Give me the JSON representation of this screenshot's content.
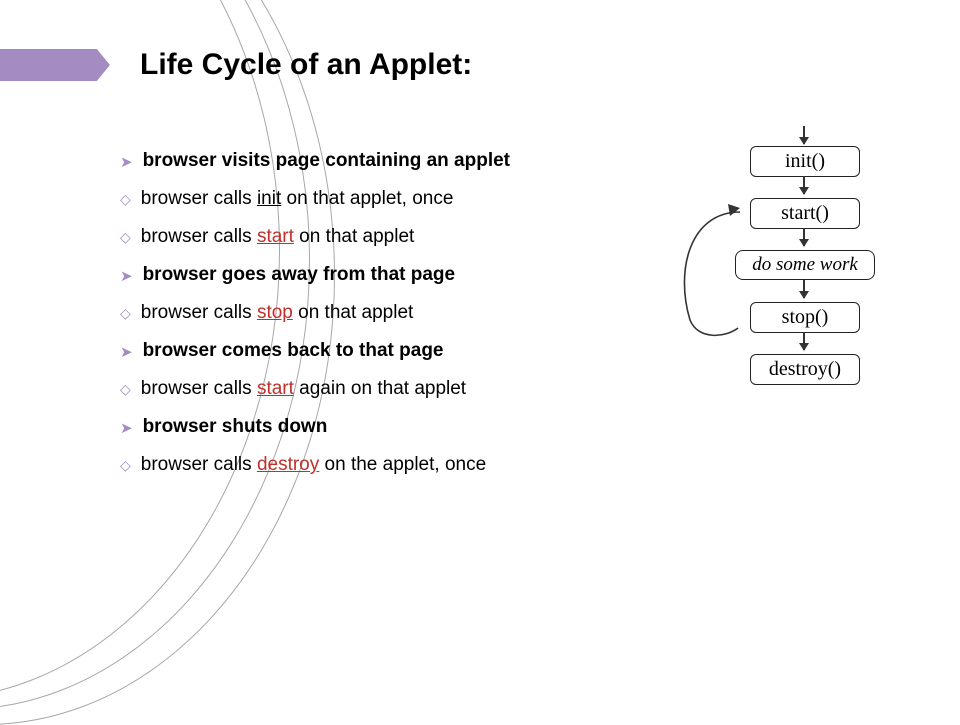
{
  "title": "Life Cycle of an Applet:",
  "bullets": [
    {
      "type": "arrow",
      "bold": true,
      "parts": [
        {
          "t": " browser visits page containing an applet"
        }
      ]
    },
    {
      "type": "diamond",
      "parts": [
        {
          "t": "browser calls "
        },
        {
          "t": "init",
          "ul": true
        },
        {
          "t": " on that applet, once"
        }
      ]
    },
    {
      "type": "diamond",
      "parts": [
        {
          "t": "browser calls "
        },
        {
          "t": "start",
          "red": true,
          "ul": true
        },
        {
          "t": " on that applet"
        }
      ]
    },
    {
      "type": "arrow",
      "bold": true,
      "parts": [
        {
          "t": " browser goes away from that page"
        }
      ]
    },
    {
      "type": "diamond",
      "parts": [
        {
          "t": "browser calls "
        },
        {
          "t": "stop",
          "red": true,
          "ul": true
        },
        {
          "t": " on that applet"
        }
      ]
    },
    {
      "type": "arrow",
      "bold": true,
      "parts": [
        {
          "t": "browser comes back to that page"
        }
      ]
    },
    {
      "type": "diamond",
      "parts": [
        {
          "t": "browser calls "
        },
        {
          "t": "start",
          "red": true,
          "ul": true
        },
        {
          "t": " again on that applet"
        }
      ]
    },
    {
      "type": "arrow",
      "bold": true,
      "parts": [
        {
          "t": "browser shuts down"
        }
      ]
    },
    {
      "type": "diamond",
      "parts": [
        {
          "t": "browser calls "
        },
        {
          "t": "destroy",
          "red": true,
          "ul": true
        },
        {
          "t": " on the applet, once"
        }
      ]
    }
  ],
  "diagram": {
    "nodes": [
      "init()",
      "start()",
      "do some work",
      "stop()",
      "destroy()"
    ]
  }
}
